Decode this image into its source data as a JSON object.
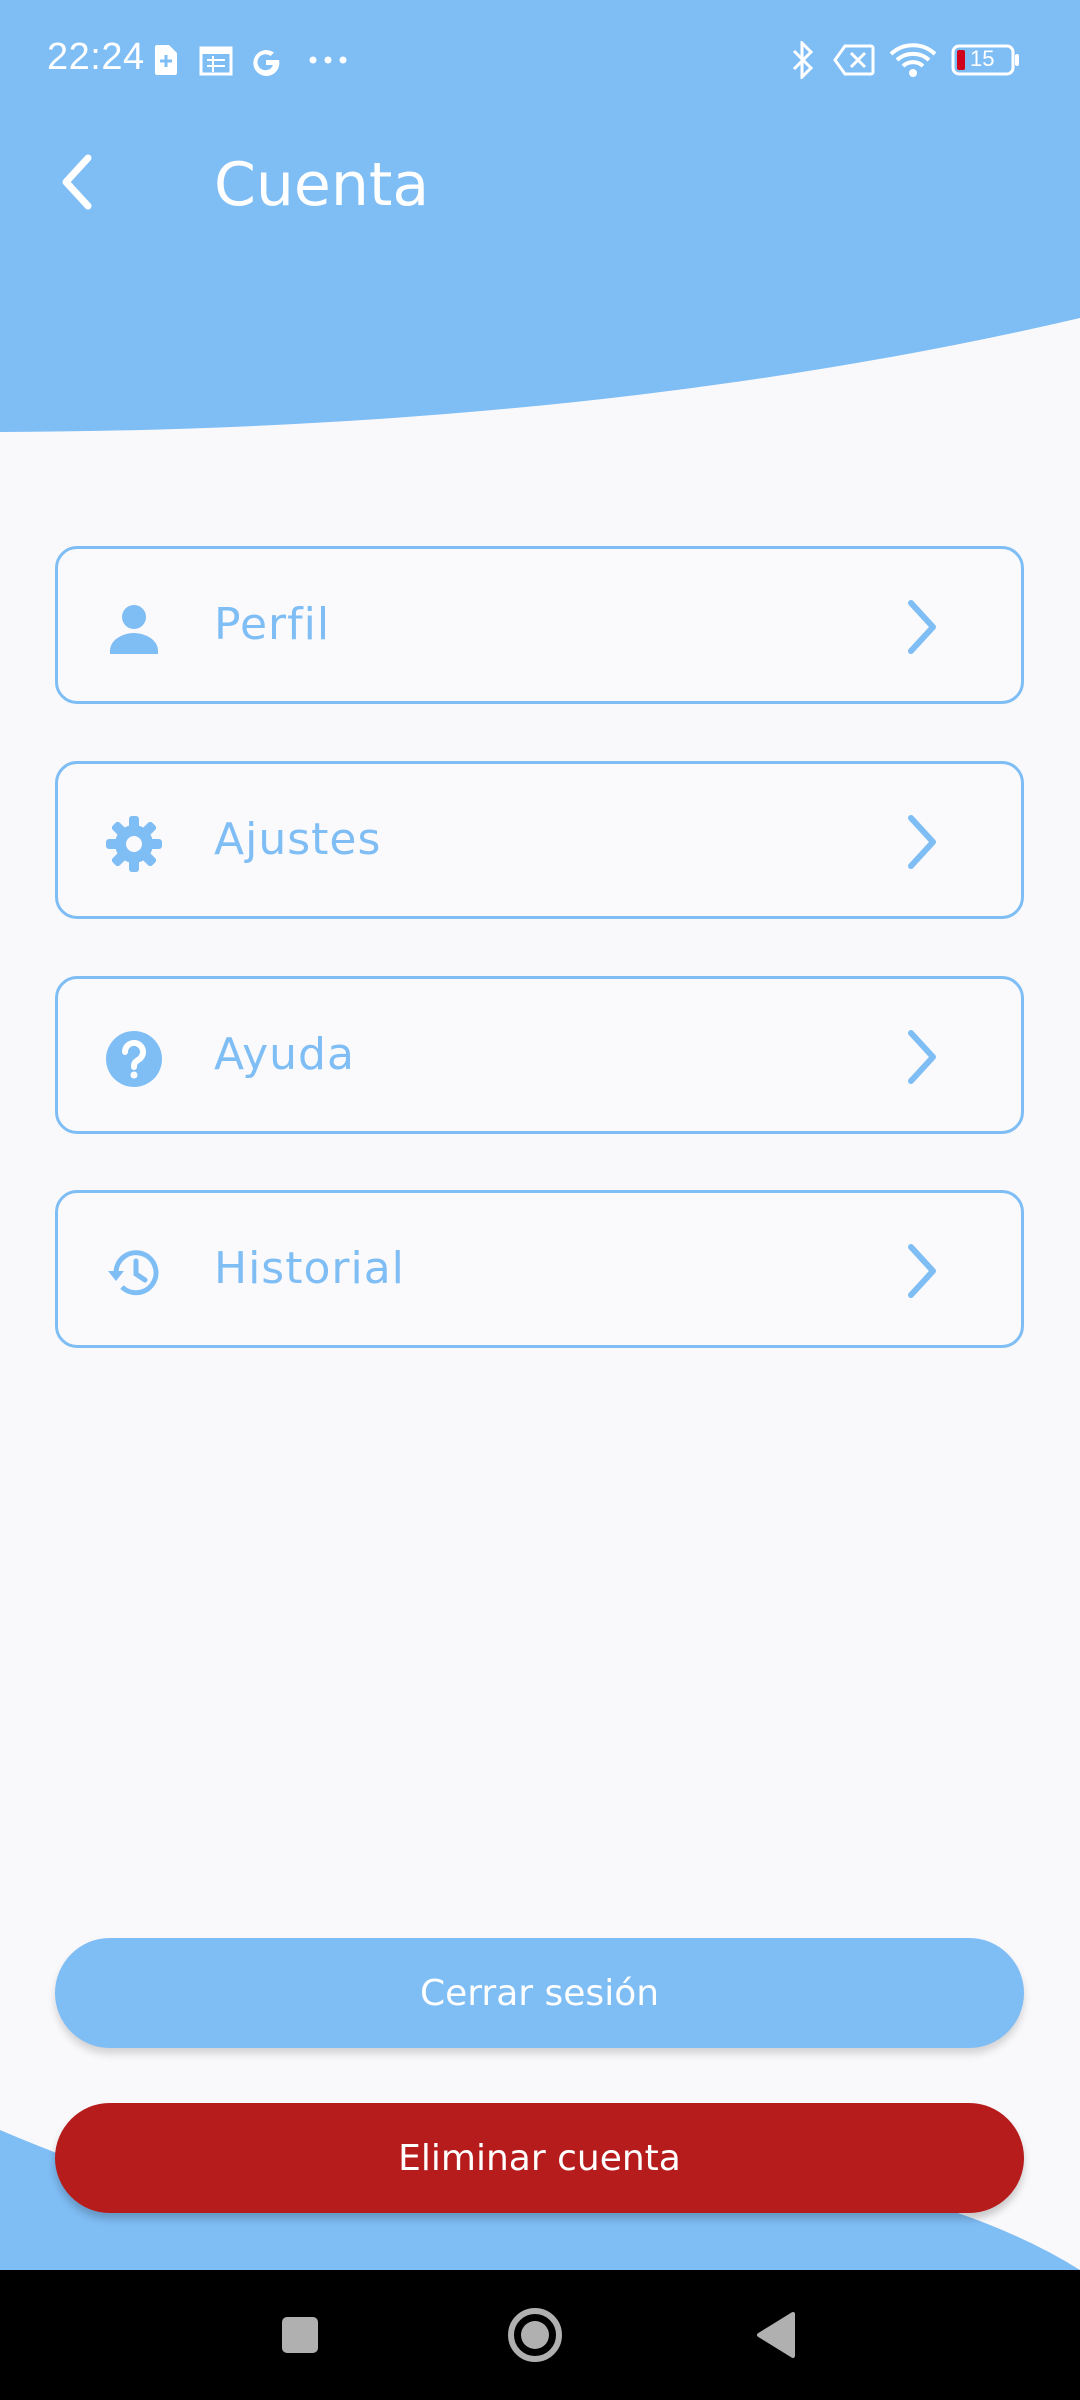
{
  "colors": {
    "accent": "#7fbdf5",
    "danger": "#b71c1c",
    "background": "#f9f9fb"
  },
  "status_bar": {
    "time": "22:24",
    "battery_level": "15",
    "icons": [
      "sim-card-icon",
      "calendar-icon",
      "google-icon",
      "more-dots-icon",
      "bluetooth-icon",
      "no-signal-icon",
      "wifi-icon",
      "battery-icon"
    ]
  },
  "app_bar": {
    "title": "Cuenta",
    "back_icon": "back-arrow-icon"
  },
  "menu": {
    "items": [
      {
        "label": "Perfil",
        "icon": "person-icon"
      },
      {
        "label": "Ajustes",
        "icon": "gear-icon"
      },
      {
        "label": "Ayuda",
        "icon": "help-icon"
      },
      {
        "label": "Historial",
        "icon": "history-icon"
      }
    ]
  },
  "actions": {
    "logout_label": "Cerrar sesión",
    "delete_label": "Eliminar cuenta"
  },
  "nav_bar": {
    "buttons": [
      "recents-icon",
      "home-icon",
      "back-triangle-icon"
    ]
  }
}
